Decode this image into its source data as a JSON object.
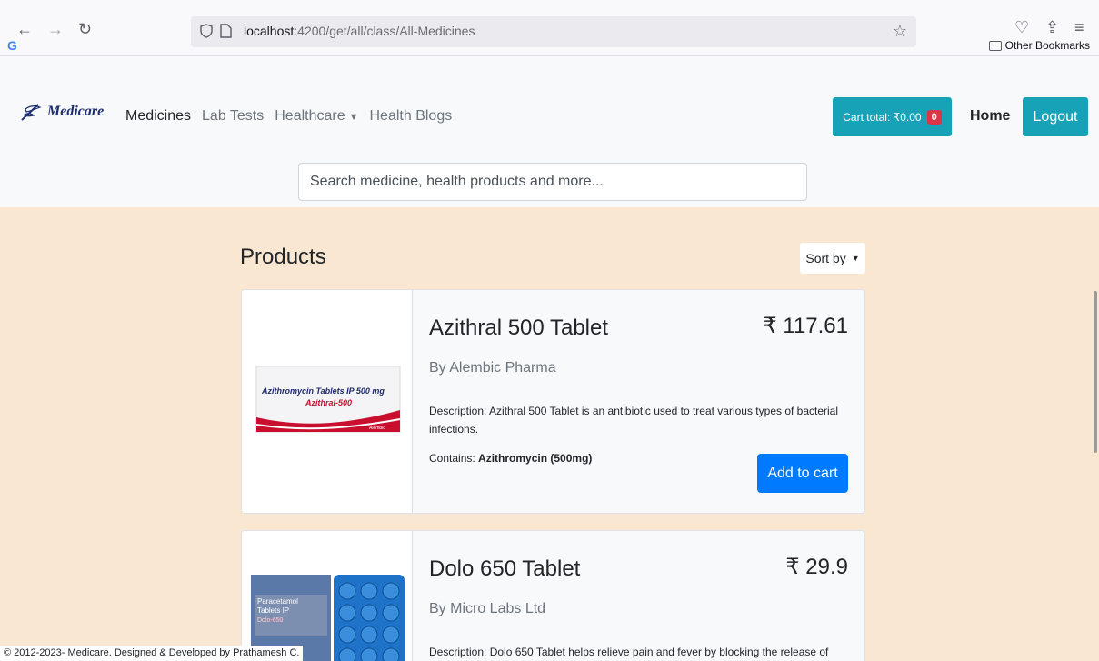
{
  "browser": {
    "url_host": "localhost",
    "url_path": ":4200/get/all/class/All-Medicines",
    "bookmarks_label": "Other Bookmarks"
  },
  "header": {
    "brand": "Medicare",
    "nav": [
      "Medicines",
      "Lab Tests",
      "Healthcare",
      "Health Blogs"
    ],
    "cart_label": "Cart total: ₹0.00",
    "cart_count": "0",
    "home_label": "Home",
    "logout_label": "Logout",
    "search_placeholder": "Search medicine, health products and more..."
  },
  "main": {
    "title": "Products",
    "sort_label": "Sort by",
    "products": [
      {
        "name": "Azithral 500 Tablet",
        "price": "₹ 117.61",
        "brand": "By Alembic Pharma",
        "description": "Description: Azithral 500 Tablet is an antibiotic used to treat various types of bacterial infections.",
        "contains_label": "Contains:",
        "contains": "Azithromycin (500mg)",
        "add_label": "Add to cart",
        "pack_line1": "Azithromycin Tablets IP 500 mg",
        "pack_line2": "Azithral-500",
        "pack_brand": "Alembic"
      },
      {
        "name": "Dolo 650 Tablet",
        "price": "₹ 29.9",
        "brand": "By Micro Labs Ltd",
        "description": "Description: Dolo 650 Tablet helps relieve pain and fever by blocking the release of",
        "pack_line1": "Paracetamol",
        "pack_line2": "Tablets IP",
        "pack_line3": "Dolo-650"
      }
    ]
  },
  "footer": {
    "text": "© 2012-2023- Medicare. Designed & Developed by Prathamesh C."
  },
  "colors": {
    "accent": "#17a2b8",
    "primary": "#007bff",
    "danger": "#dc3545",
    "content_bg": "#fae7d1"
  }
}
